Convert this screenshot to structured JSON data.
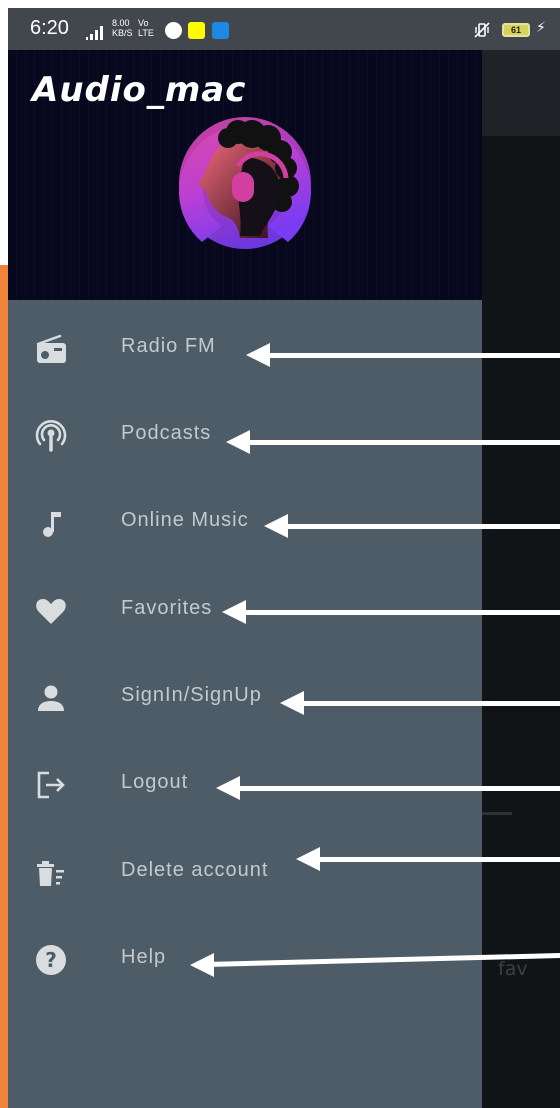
{
  "status_bar": {
    "time": "6:20",
    "network_speed_value": "8.00",
    "network_speed_unit": "KB/S",
    "network_type": "Vo LTE",
    "battery_level": "61"
  },
  "drawer": {
    "app_title": "Audio_mac",
    "items": [
      {
        "label": "Radio FM",
        "icon": "radio-icon"
      },
      {
        "label": "Podcasts",
        "icon": "podcast-icon"
      },
      {
        "label": "Online Music",
        "icon": "music-note-icon"
      },
      {
        "label": "Favorites",
        "icon": "heart-icon"
      },
      {
        "label": "SignIn/SignUp",
        "icon": "person-icon"
      },
      {
        "label": "Logout",
        "icon": "logout-icon"
      },
      {
        "label": "Delete account",
        "icon": "delete-account-icon"
      },
      {
        "label": "Help",
        "icon": "help-icon"
      }
    ]
  },
  "background_page": {
    "partial_text": "fav"
  },
  "colors": {
    "drawer_background": "#4d5c67",
    "header_background": "#07071e",
    "label_text": "#c4c9cd",
    "icon": "#d9dde0",
    "annotation_arrow": "#ffffff"
  }
}
